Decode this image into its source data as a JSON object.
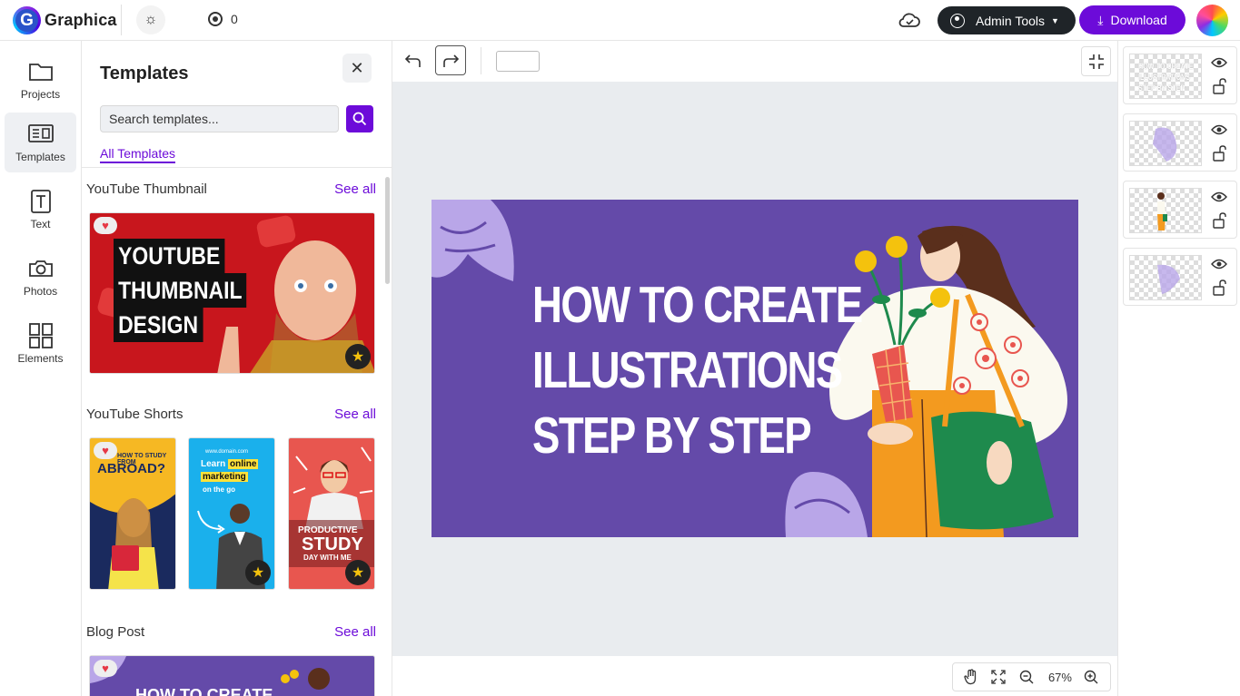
{
  "app": {
    "name": "Graphica",
    "logo_letter": "G",
    "credits": "0"
  },
  "header": {
    "admin_label": "Admin Tools",
    "download_label": "Download"
  },
  "nav": [
    {
      "label": "Projects",
      "icon": "folder-icon"
    },
    {
      "label": "Templates",
      "icon": "templates-icon",
      "active": true
    },
    {
      "label": "Text",
      "icon": "text-icon"
    },
    {
      "label": "Photos",
      "icon": "camera-icon"
    },
    {
      "label": "Elements",
      "icon": "elements-icon"
    }
  ],
  "panel": {
    "title": "Templates",
    "search_placeholder": "Search templates...",
    "tab": "All Templates",
    "see_all": "See all",
    "sections": [
      {
        "title": "YouTube Thumbnail",
        "thumbs": [
          {
            "lines": [
              "YOUTUBE",
              "THUMBNAIL",
              "DESIGN"
            ]
          }
        ]
      },
      {
        "title": "YouTube Shorts",
        "thumbs": [
          {
            "top": "HOW TO STUDY FROM",
            "main": "ABROAD?"
          },
          {
            "top": "www.domain.com",
            "line1": "Learn",
            "hl": "online",
            "line2": "marketing",
            "line3": "on the go"
          },
          {
            "top": "PRODUCTIVE",
            "main": "STUDY",
            "sub": "DAY WITH ME"
          }
        ]
      },
      {
        "title": "Blog Post",
        "thumbs": [
          {
            "text": "HOW TO CREATE"
          }
        ]
      }
    ]
  },
  "canvas": {
    "headline": [
      "HOW TO CREATE",
      "ILLUSTRATIONS",
      "STEP BY STEP"
    ],
    "bg_color": "#644aa9",
    "zoom": "67%"
  },
  "layers": [
    {
      "kind": "text",
      "preview": [
        "HOW TO CREATE",
        "ILLUSTRATIONS",
        "STEP BY STEP"
      ]
    },
    {
      "kind": "shape"
    },
    {
      "kind": "figure"
    },
    {
      "kind": "shape"
    }
  ],
  "colors": {
    "accent": "#6c0bd9",
    "dark_button": "#1f2428",
    "canvas_bg": "#e9ecef"
  }
}
